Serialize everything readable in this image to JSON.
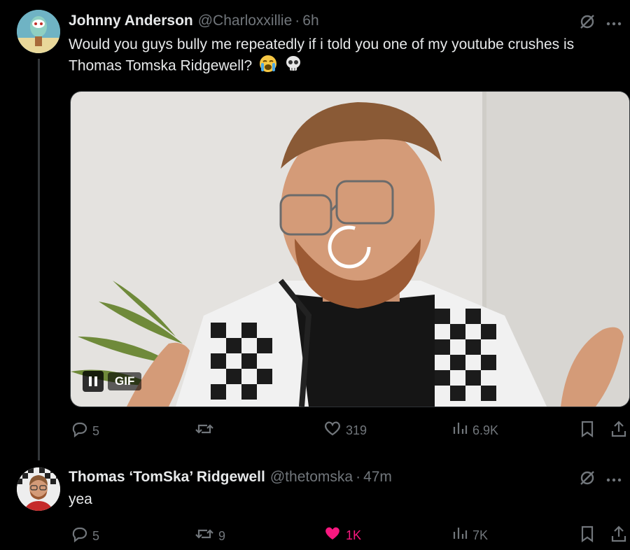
{
  "tweet": {
    "author_name": "Johnny Anderson",
    "author_handle": "@Charloxxillie",
    "dot": "·",
    "time": "6h",
    "text": "Would you guys bully me repeatedly if i told you one of my youtube crushes is Thomas Tomska Ridgewell?",
    "media": {
      "badge": "GIF"
    },
    "stats": {
      "replies": "5",
      "reposts": "",
      "likes": "319",
      "views": "6.9K"
    }
  },
  "reply": {
    "author_name": "Thomas ‘TomSka’ Ridgewell",
    "author_handle": "@thetomska",
    "dot": "·",
    "time": "47m",
    "text": "yea",
    "stats": {
      "replies": "5",
      "reposts": "9",
      "likes": "1K",
      "views": "7K"
    }
  },
  "colors": {
    "background": "#000000",
    "text": "#e7e9ea",
    "muted": "#71767b",
    "like_active": "#f91880"
  },
  "icons": [
    "grok-icon",
    "more-icon",
    "reply-icon",
    "repost-icon",
    "like-icon",
    "views-icon",
    "bookmark-icon",
    "share-icon",
    "pause-icon"
  ]
}
